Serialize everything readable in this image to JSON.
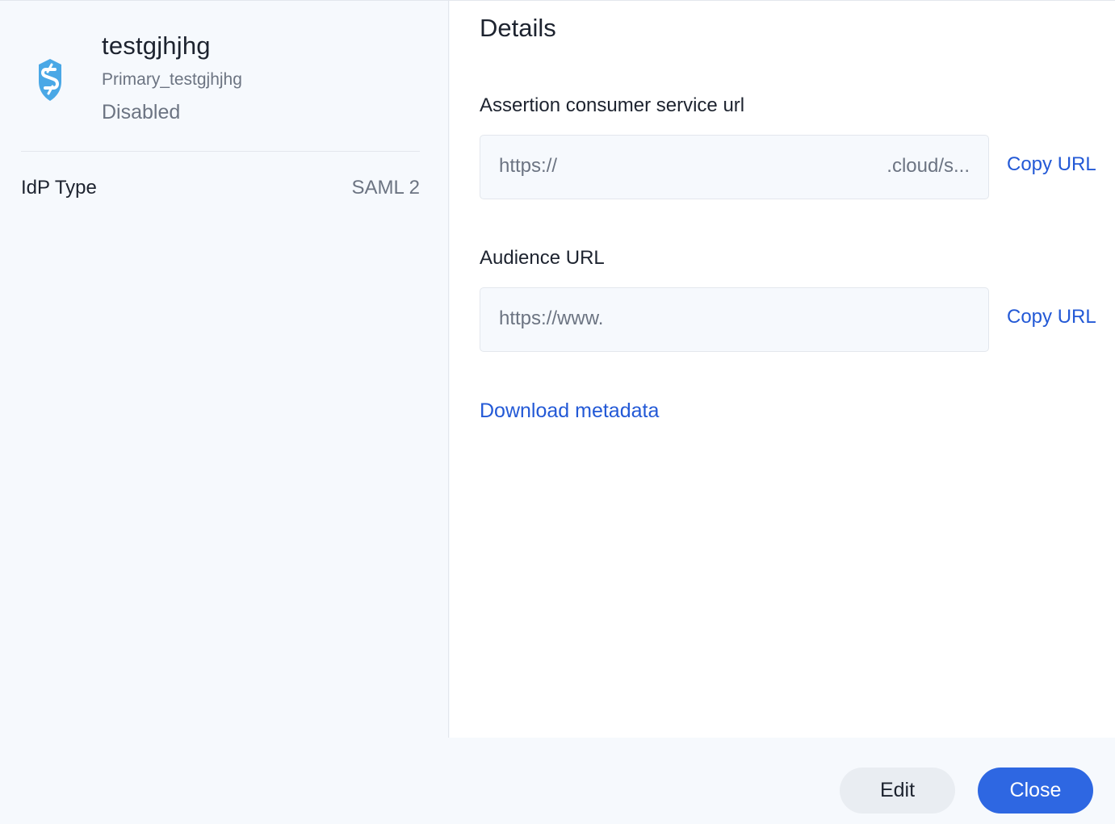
{
  "idp": {
    "name": "testgjhjhg",
    "subname": "Primary_testgjhjhg",
    "status": "Disabled",
    "logo_icon": "shield-s-icon",
    "logo_color": "#4aa8e6",
    "type_label": "IdP Type",
    "type_value": "SAML 2"
  },
  "details": {
    "title": "Details",
    "acs": {
      "label": "Assertion consumer service url",
      "url_start": "https://",
      "url_end": ".cloud/s...",
      "copy_label": "Copy URL"
    },
    "audience": {
      "label": "Audience URL",
      "url_start": "https://www.",
      "copy_label": "Copy URL"
    },
    "download_label": "Download metadata"
  },
  "footer": {
    "edit_label": "Edit",
    "close_label": "Close"
  },
  "colors": {
    "accent": "#2e67e2",
    "link": "#2359d6",
    "panel_bg": "#f6f9fd"
  }
}
